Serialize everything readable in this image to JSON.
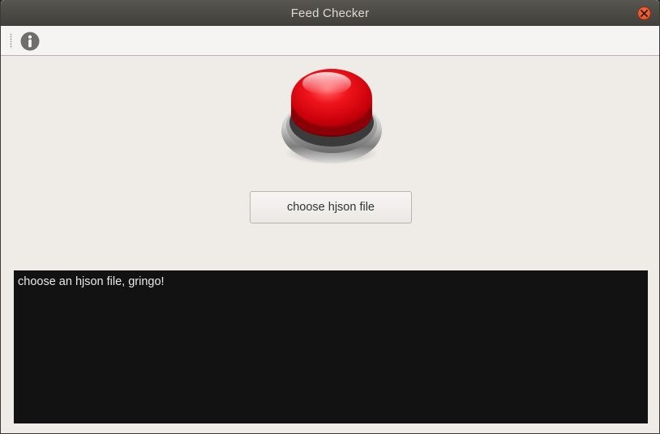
{
  "window": {
    "title": "Feed Checker",
    "close_icon": "close-icon"
  },
  "toolbar": {
    "info_icon": "info-icon"
  },
  "main": {
    "big_button_icon": "red-push-button-icon",
    "choose_button_label": "choose hjson file",
    "output_text": "choose an hjson file, gringo!"
  },
  "colors": {
    "titlebar": "#46453f",
    "window_bg": "#efebe7",
    "close_accent": "#e05a2b",
    "output_bg": "#121212",
    "output_text": "#e8e8e8"
  }
}
